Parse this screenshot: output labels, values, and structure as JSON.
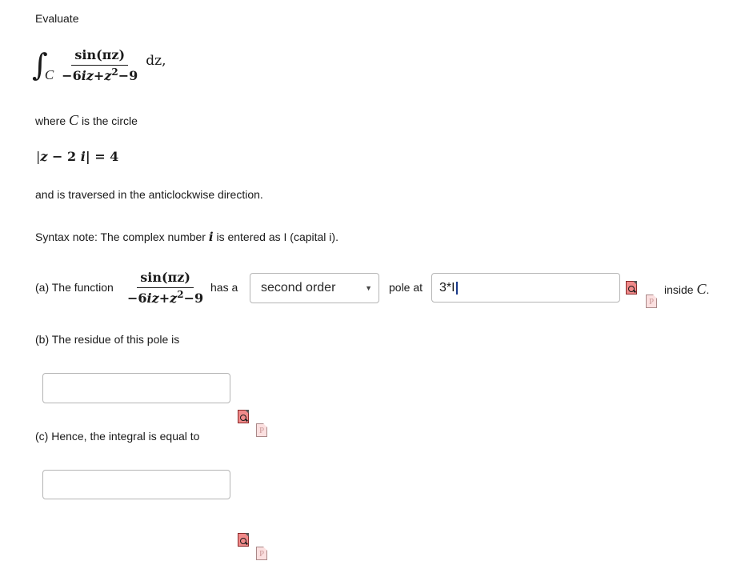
{
  "problem": {
    "intro": "Evaluate",
    "integral": {
      "contour": "C",
      "numerator": "sin(πz)",
      "denominator_parts": [
        "−6",
        "i",
        "z",
        "+",
        "z",
        "2",
        "−9"
      ],
      "differential": "dz,"
    },
    "where_prefix": "where",
    "where_var": "C",
    "where_suffix": "is the circle",
    "circle_equation": {
      "lhs_open": "|",
      "z": "z",
      "minus": " − 2 ",
      "i": "i",
      "rhs": "| = 4"
    },
    "direction_text": "and is traversed in the anticlockwise direction.",
    "syntax_note_prefix": "Syntax note: The complex number",
    "syntax_note_var": "i",
    "syntax_note_suffix": "is entered as I (capital i)."
  },
  "part_a": {
    "prefix": "(a) The function",
    "function_numerator": "sin(πz)",
    "has_a": "has a",
    "order_select": {
      "selected": "second order"
    },
    "pole_at_label": "pole at",
    "pole_input_value": "3*I",
    "suffix": "inside",
    "suffix_var": "C",
    "suffix_end": "."
  },
  "part_b": {
    "label": "(b) The residue of this pole is",
    "input_value": ""
  },
  "part_c": {
    "label": "(c) Hence, the integral is equal to",
    "input_value": ""
  },
  "icons": {
    "preview": "preview-answer-icon",
    "help": "help-document-icon",
    "help_glyph": "P"
  }
}
